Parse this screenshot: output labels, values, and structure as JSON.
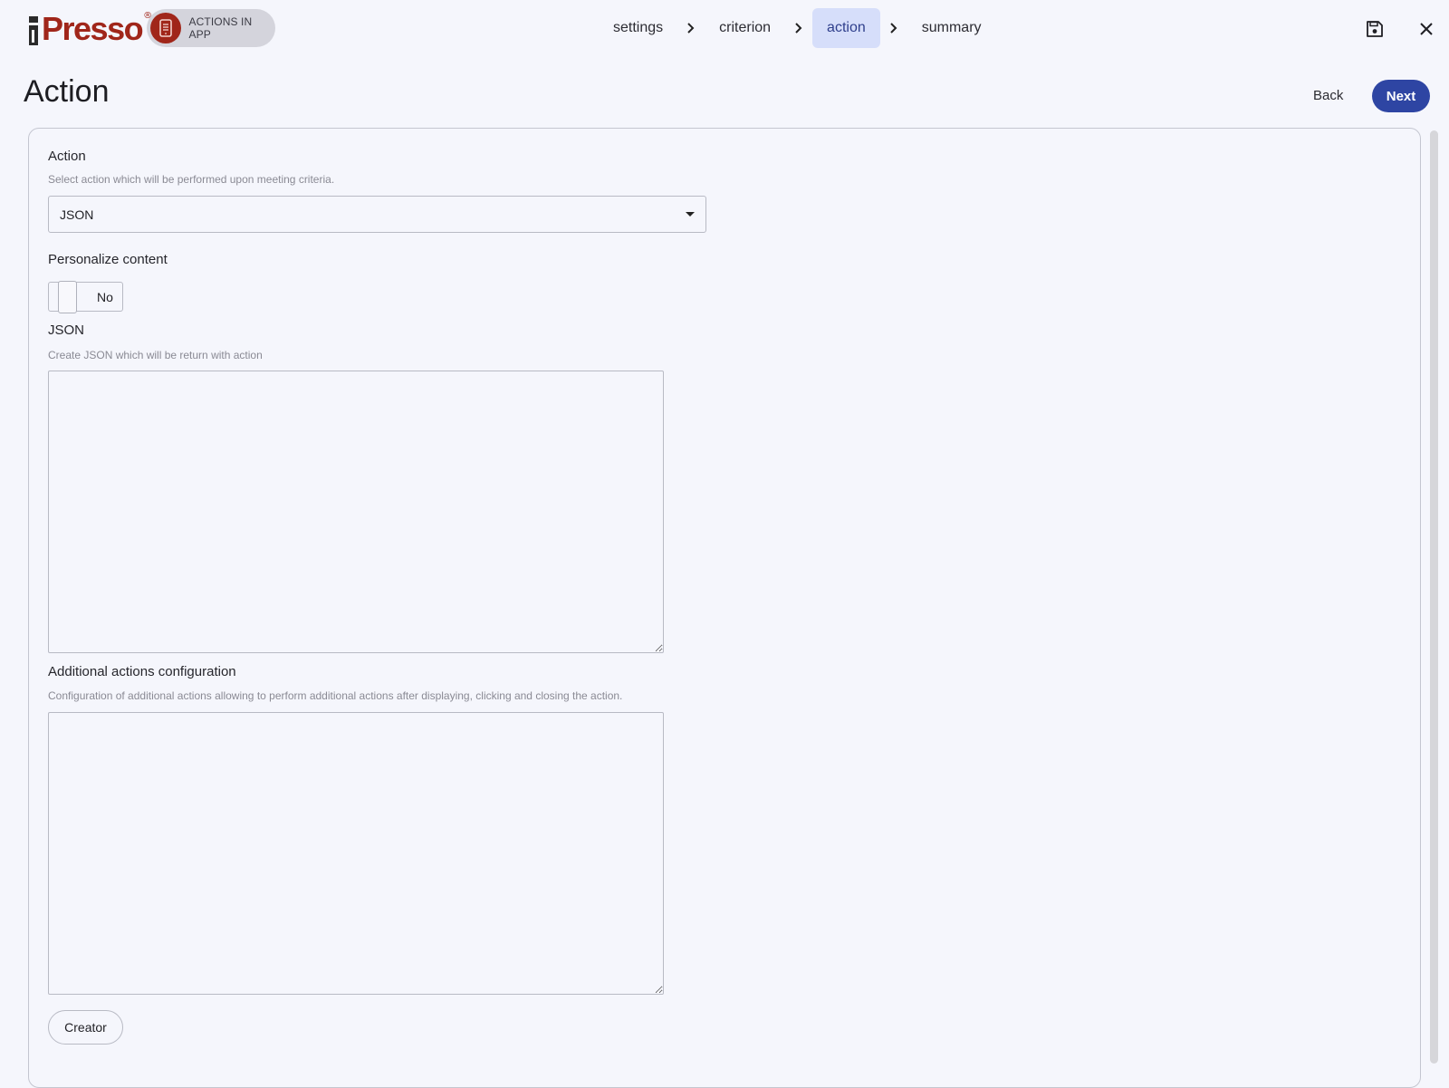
{
  "brand": {
    "logo_text": "Presso",
    "logo_mark": "®",
    "module_label": "ACTIONS IN APP",
    "accent": "#a0261a"
  },
  "wizard": {
    "steps": [
      {
        "label": "settings",
        "active": false
      },
      {
        "label": "criterion",
        "active": false
      },
      {
        "label": "action",
        "active": true
      },
      {
        "label": "summary",
        "active": false
      }
    ]
  },
  "page": {
    "title": "Action",
    "back_label": "Back",
    "next_label": "Next",
    "primary_color": "#2e45a3"
  },
  "form": {
    "action": {
      "label": "Action",
      "hint": "Select action which will be performed upon meeting criteria.",
      "value": "JSON"
    },
    "personalize": {
      "label": "Personalize content",
      "value": "No"
    },
    "json": {
      "label": "JSON",
      "hint": "Create JSON which will be return with action",
      "value": ""
    },
    "additional": {
      "label": "Additional actions configuration",
      "hint": "Configuration of additional actions allowing to perform additional actions after displaying, clicking and closing the action.",
      "value": ""
    },
    "creator_label": "Creator"
  },
  "icons": {
    "save": "floppy-disk-icon",
    "close": "close-icon",
    "separator": "chevron-right-icon",
    "module": "tablet-icon"
  }
}
